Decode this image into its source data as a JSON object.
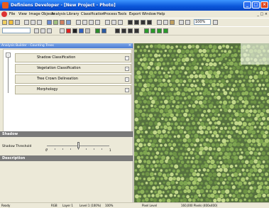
{
  "window": {
    "title": "Definiens Developer - [New Project - Photo]",
    "minimize_label": "_",
    "maximize_label": "□",
    "close_label": "×"
  },
  "menu": {
    "items": [
      "File",
      "View",
      "Image Objects",
      "Analysis",
      "Library",
      "Classification",
      "Process",
      "Tools",
      "Export",
      "Window",
      "Help"
    ],
    "controls": "_ □ ×"
  },
  "toolbar": {
    "zoom_value": "100%",
    "field_value": ""
  },
  "left_panel": {
    "title": "Analysis Builder - Counting Trees",
    "close_label": "×",
    "tree_items": [
      "Shadow Classification",
      "Vegetation Classification",
      "Tree Crown Delineation",
      "Morphology"
    ],
    "shadow_header": "Shadow",
    "slider_label": "Shadow Threshold",
    "slider_min": "0",
    "slider_max": "1",
    "slider_value": 0.5,
    "description_header": "Description"
  },
  "status": {
    "ready": "Ready",
    "rgb": "RGB",
    "layer": "Layer 1",
    "level": "Level 1 (100%)",
    "zoom": "100%",
    "pixel_level": "Pixel Level",
    "pixels": "160,000 Pixels (400x400)"
  },
  "colors": {
    "titlebar": "#0a55d9",
    "panel_bg": "#ece9d8",
    "section_header": "#7a7a7a",
    "canopy": "#4f6a3c"
  }
}
